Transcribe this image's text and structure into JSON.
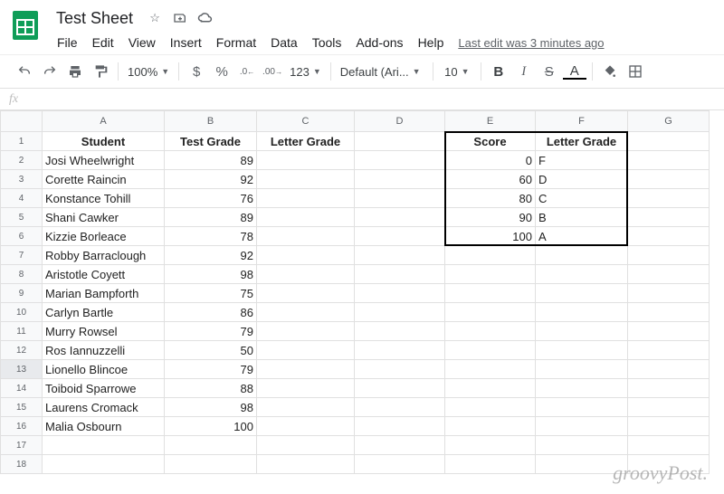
{
  "doc": {
    "title": "Test Sheet",
    "last_edit": "Last edit was 3 minutes ago"
  },
  "menu": [
    "File",
    "Edit",
    "View",
    "Insert",
    "Format",
    "Data",
    "Tools",
    "Add-ons",
    "Help"
  ],
  "toolbar": {
    "zoom": "100%",
    "currency": "$",
    "percent": "%",
    "dec_dec": ".0",
    "dec_inc": ".00",
    "numfmt": "123",
    "font": "Default (Ari...",
    "size": "10",
    "bold": "B",
    "italic": "I",
    "strike": "S",
    "underlineA": "A"
  },
  "fx": "fx",
  "columns": [
    "A",
    "B",
    "C",
    "D",
    "E",
    "F",
    "G"
  ],
  "headers": {
    "A": "Student",
    "B": "Test Grade",
    "C": "Letter Grade",
    "E": "Score",
    "F": "Letter Grade"
  },
  "students": [
    {
      "name": "Josi Wheelwright",
      "grade": 89
    },
    {
      "name": "Corette Raincin",
      "grade": 92
    },
    {
      "name": "Konstance Tohill",
      "grade": 76
    },
    {
      "name": "Shani Cawker",
      "grade": 89
    },
    {
      "name": "Kizzie Borleace",
      "grade": 78
    },
    {
      "name": "Robby Barraclough",
      "grade": 92
    },
    {
      "name": "Aristotle Coyett",
      "grade": 98
    },
    {
      "name": "Marian Bampforth",
      "grade": 75
    },
    {
      "name": "Carlyn Bartle",
      "grade": 86
    },
    {
      "name": "Murry Rowsel",
      "grade": 79
    },
    {
      "name": "Ros Iannuzzelli",
      "grade": 50
    },
    {
      "name": "Lionello Blincoe",
      "grade": 79
    },
    {
      "name": "Toiboid Sparrowe",
      "grade": 88
    },
    {
      "name": "Laurens Cromack",
      "grade": 98
    },
    {
      "name": "Malia Osbourn",
      "grade": 100
    }
  ],
  "lookup": [
    {
      "score": 0,
      "letter": "F"
    },
    {
      "score": 60,
      "letter": "D"
    },
    {
      "score": 80,
      "letter": "C"
    },
    {
      "score": 90,
      "letter": "B"
    },
    {
      "score": 100,
      "letter": "A"
    }
  ],
  "selected_row": 13,
  "watermark": "groovyPost."
}
